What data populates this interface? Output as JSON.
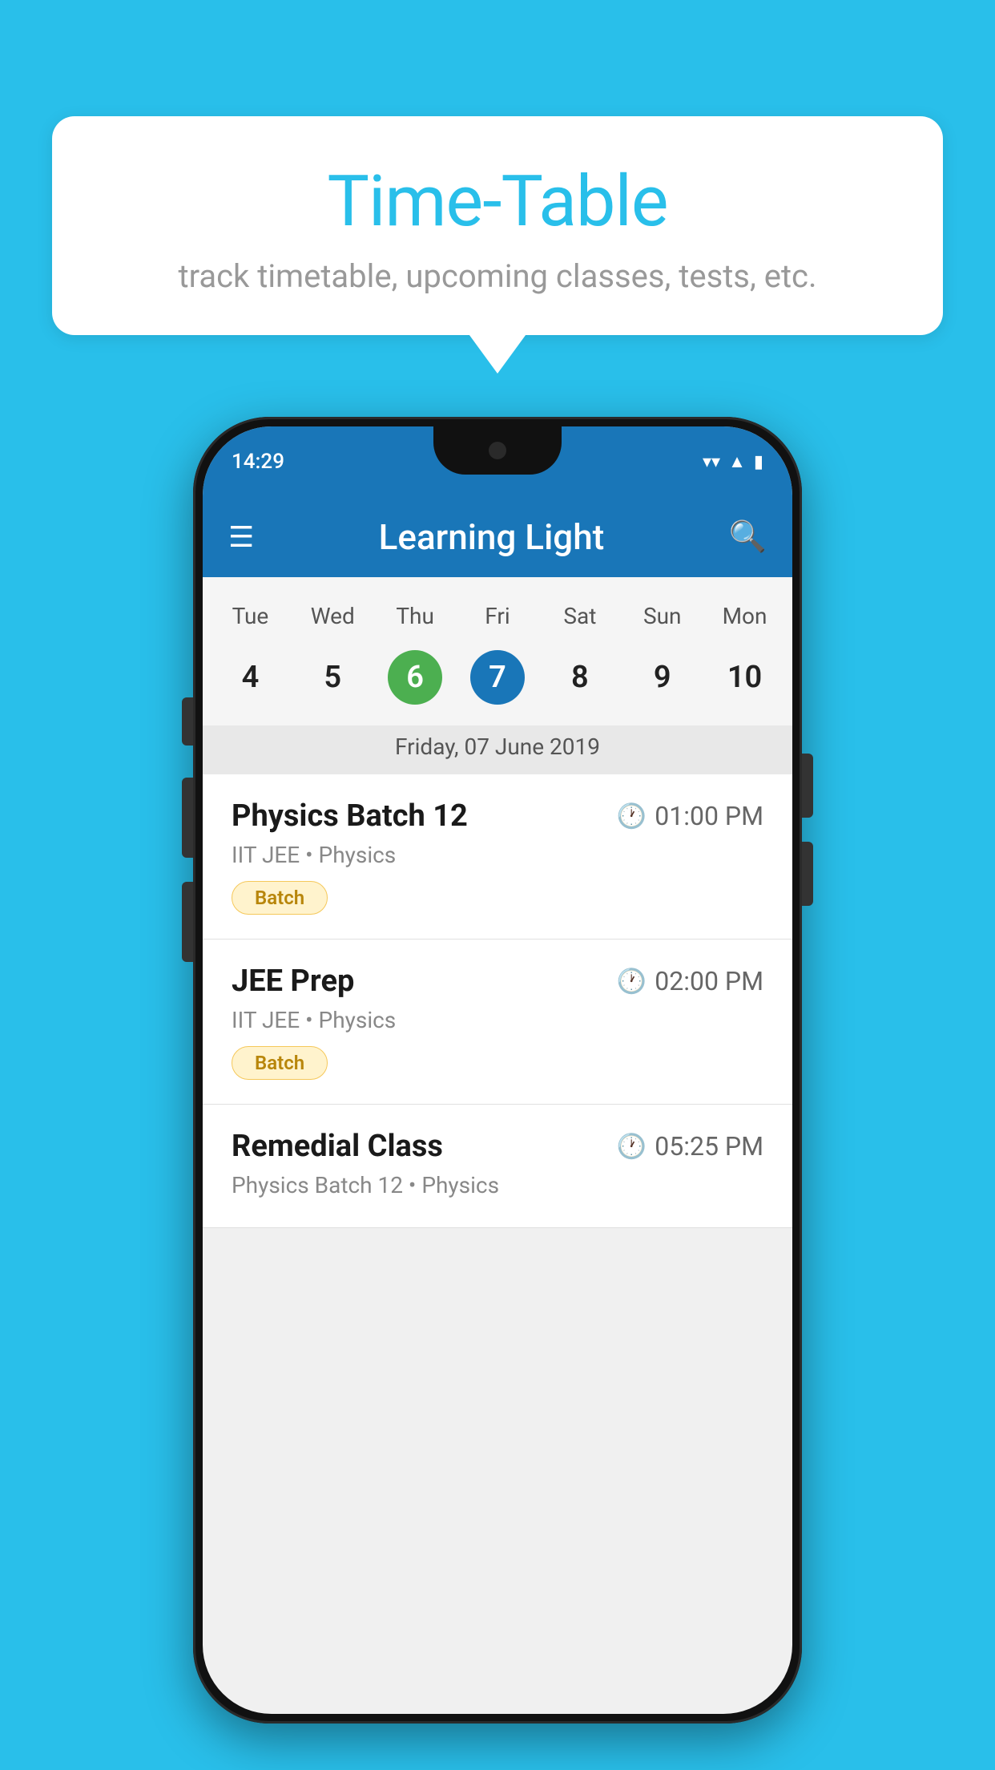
{
  "background_color": "#29BFEA",
  "tooltip": {
    "title": "Time-Table",
    "subtitle": "track timetable, upcoming classes, tests, etc."
  },
  "phone": {
    "status_bar": {
      "time": "14:29"
    },
    "app_bar": {
      "title": "Learning Light",
      "menu_icon": "☰",
      "search_icon": "🔍"
    },
    "calendar": {
      "days_of_week": [
        "Tue",
        "Wed",
        "Thu",
        "Fri",
        "Sat",
        "Sun",
        "Mon"
      ],
      "dates": [
        "4",
        "5",
        "6",
        "7",
        "8",
        "9",
        "10"
      ],
      "today_index": 2,
      "selected_index": 3,
      "selected_label": "Friday, 07 June 2019"
    },
    "classes": [
      {
        "name": "Physics Batch 12",
        "time": "01:00 PM",
        "meta": "IIT JEE • Physics",
        "tag": "Batch"
      },
      {
        "name": "JEE Prep",
        "time": "02:00 PM",
        "meta": "IIT JEE • Physics",
        "tag": "Batch"
      },
      {
        "name": "Remedial Class",
        "time": "05:25 PM",
        "meta": "Physics Batch 12 • Physics",
        "tag": ""
      }
    ]
  }
}
